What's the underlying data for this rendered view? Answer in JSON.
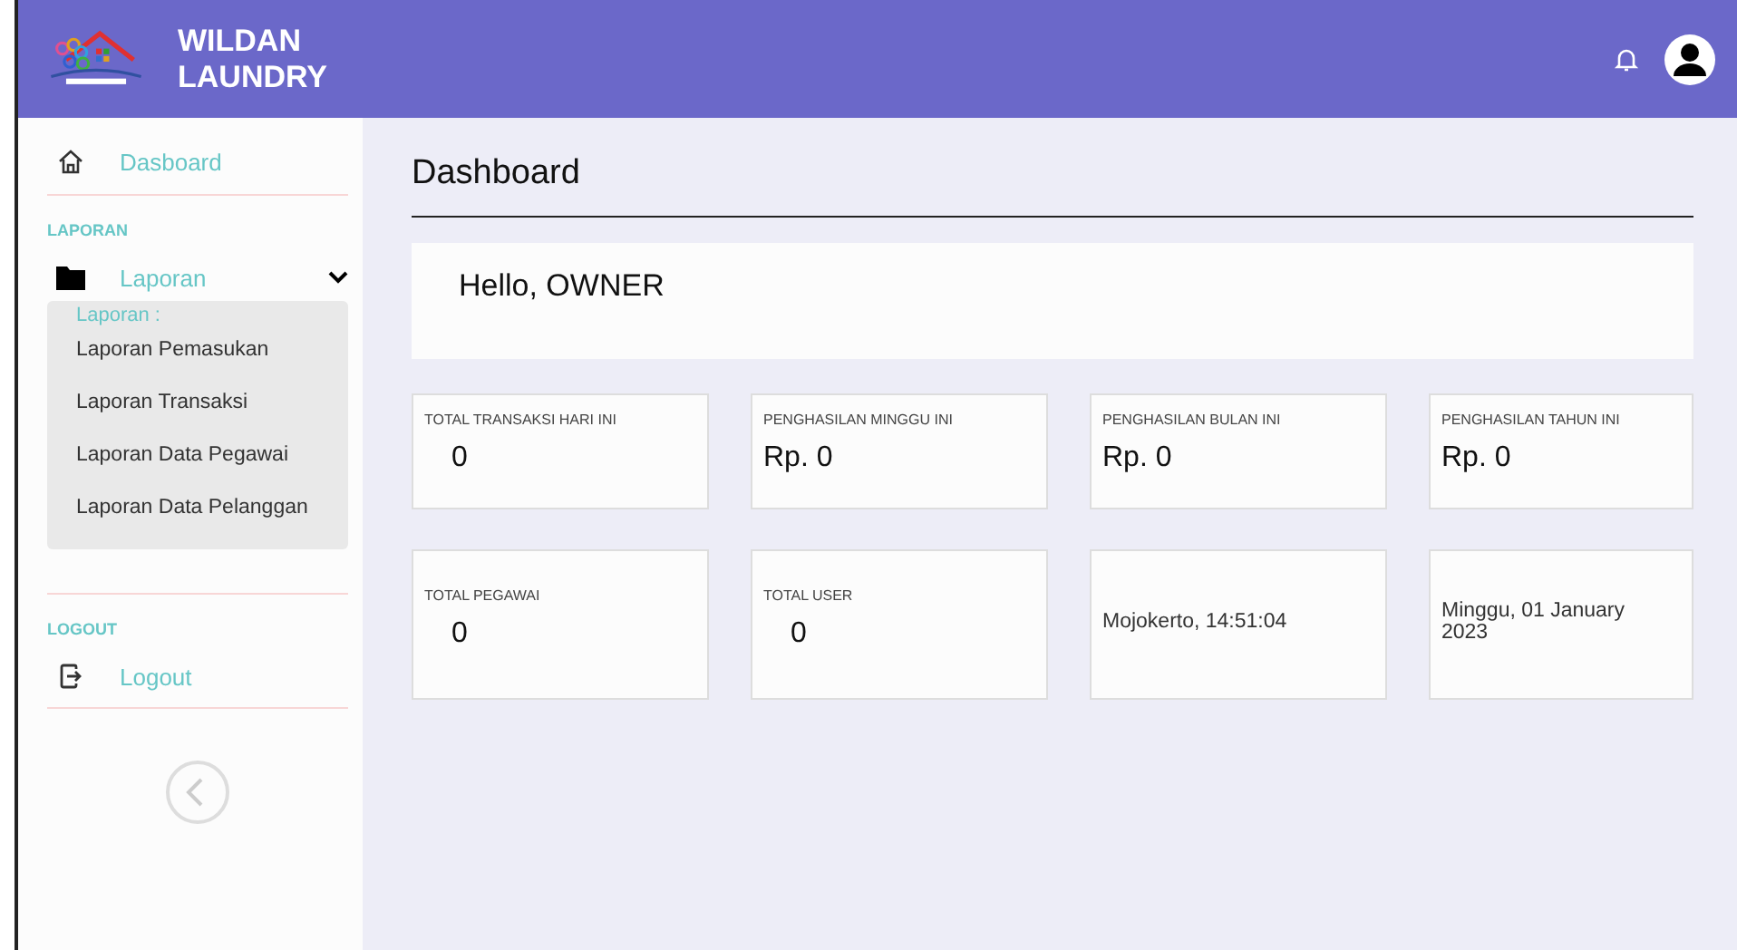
{
  "brand": {
    "title_line1": "WILDAN",
    "title_line2": "LAUNDRY"
  },
  "sidebar": {
    "home": {
      "label": "Dasboard",
      "selected": false
    },
    "sections": [
      {
        "heading": "LAPORAN",
        "item": {
          "kind": "folder",
          "label": "Laporan",
          "expanded": true
        },
        "submenu": {
          "title": "Laporan :",
          "items": [
            "Laporan Pemasukan",
            "Laporan Transaksi",
            "Laporan Data Pegawai",
            "Laporan Data Pelanggan"
          ]
        }
      },
      {
        "heading": "LOGOUT",
        "item": {
          "kind": "logout",
          "label": "Logout"
        }
      }
    ]
  },
  "page_title": "Dashboard",
  "greeting": "Hello, OWNER",
  "cards": [
    {
      "kind": "stat",
      "label": "TOTAL TRANSAKSI HARI INI",
      "value": "0"
    },
    {
      "kind": "stat",
      "label": "PENGHASILAN MINGGU INI",
      "value": "Rp. 0"
    },
    {
      "kind": "stat",
      "label": "PENGHASILAN BULAN INI",
      "value": "Rp. 0"
    },
    {
      "kind": "stat",
      "label": "PENGHASILAN TAHUN INI",
      "value": "Rp. 0"
    },
    {
      "kind": "stat",
      "label": "TOTAL PEGAWAI",
      "value": "0"
    },
    {
      "kind": "stat",
      "label": "TOTAL USER",
      "value": "0"
    },
    {
      "kind": "info",
      "text": "Mojokerto, 14:51:04"
    },
    {
      "kind": "info",
      "text": "Minggu, 01 January 2023"
    }
  ]
}
